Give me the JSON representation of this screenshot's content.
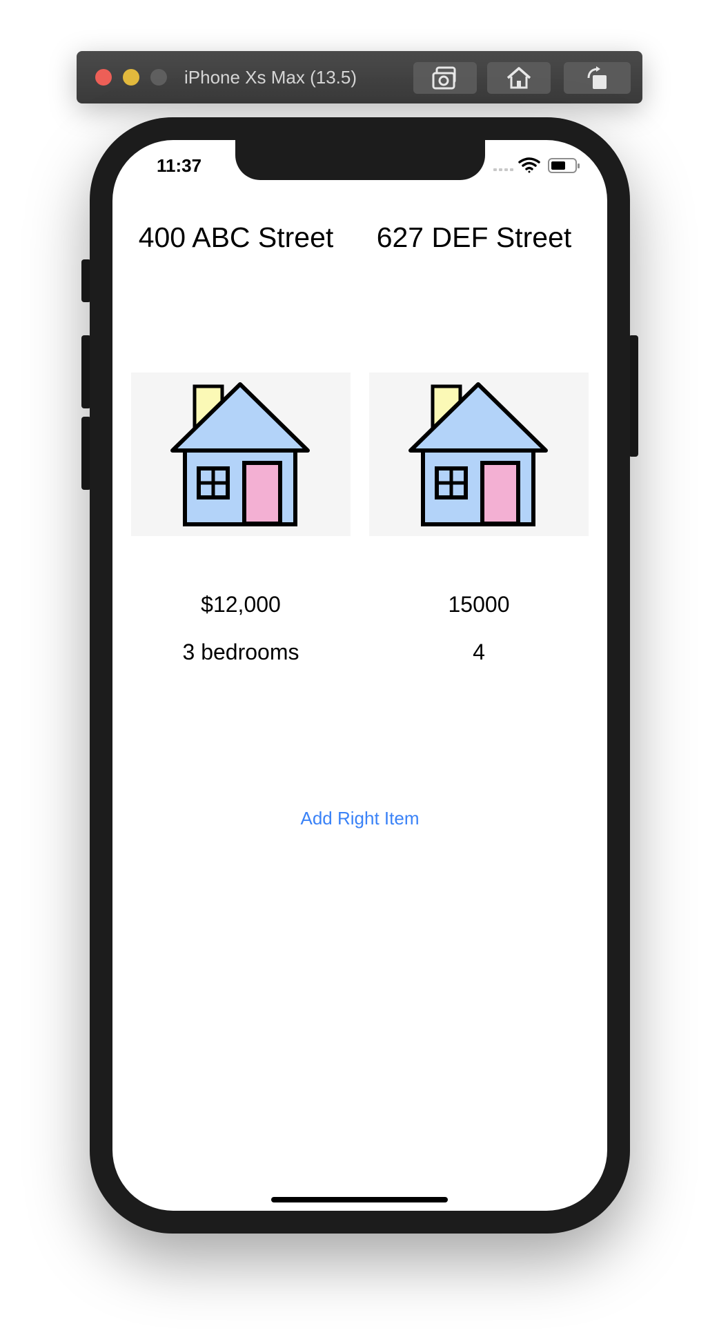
{
  "simulator": {
    "title": "iPhone Xs Max (13.5)",
    "buttons": [
      "screenshot-icon",
      "home-icon",
      "rotate-icon"
    ]
  },
  "status_bar": {
    "time": "11:37"
  },
  "listings": [
    {
      "address": "400 ABC Street",
      "price": "$12,000",
      "bedrooms": "3 bedrooms"
    },
    {
      "address": "627 DEF Street",
      "price": "15000",
      "bedrooms": "4"
    }
  ],
  "actions": {
    "add_right_item": "Add Right Item"
  },
  "colors": {
    "accent": "#3a82f7",
    "house_wall": "#b3d3f9",
    "house_door": "#f3b0d3",
    "chimney": "#fbf9b6"
  }
}
